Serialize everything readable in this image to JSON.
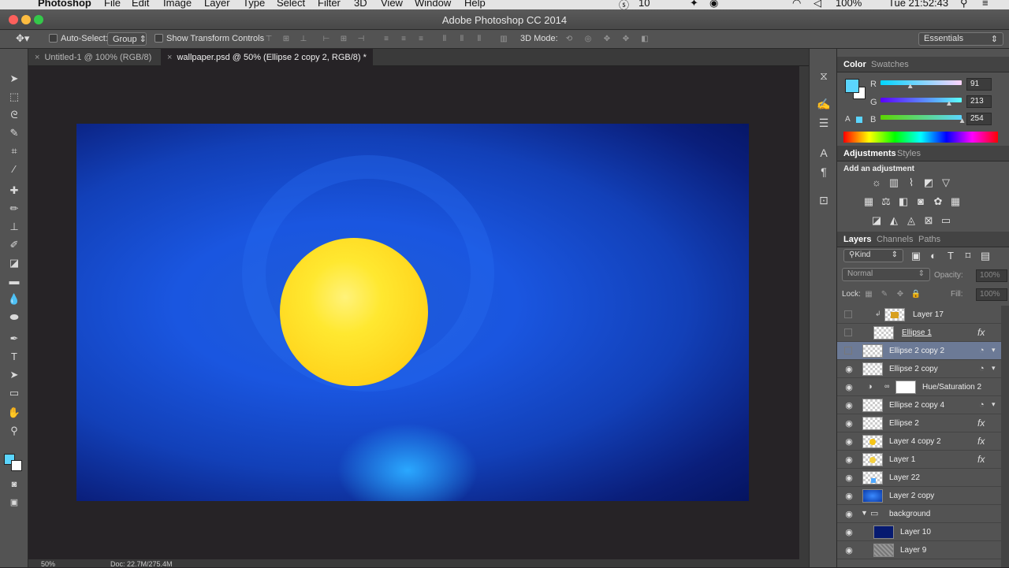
{
  "menubar": {
    "app": "Photoshop",
    "items": [
      "File",
      "Edit",
      "Image",
      "Layer",
      "Type",
      "Select",
      "Filter",
      "3D",
      "View",
      "Window",
      "Help"
    ],
    "status_count": "10",
    "battery": "100%",
    "clock": "Tue 21:52:43"
  },
  "window": {
    "title": "Adobe Photoshop CC 2014"
  },
  "options": {
    "auto_select_label": "Auto-Select:",
    "auto_select_value": "Group",
    "transform_label": "Show Transform Controls",
    "mode_3d_label": "3D Mode:",
    "workspace": "Essentials"
  },
  "tabs": [
    {
      "label": "Untitled-1 @ 100% (RGB/8)"
    },
    {
      "label": "wallpaper.psd @ 50% (Ellipse 2 copy 2, RGB/8) *"
    }
  ],
  "status": {
    "zoom": "50%",
    "doc": "Doc: 22.7M/275.4M"
  },
  "color_panel": {
    "tabs": [
      "Color",
      "Swatches"
    ],
    "r": {
      "label": "R",
      "value": "91"
    },
    "g": {
      "label": "G",
      "value": "213"
    },
    "b": {
      "label": "B",
      "value": "254"
    },
    "fg_color": "#5bd5fe",
    "r_level": 0.357,
    "g_level": 0.835,
    "b_level": 0.996
  },
  "adjustments_panel": {
    "tabs": [
      "Adjustments",
      "Styles"
    ],
    "heading": "Add an adjustment"
  },
  "layers_panel": {
    "tabs": [
      "Layers",
      "Channels",
      "Paths"
    ],
    "filter_kind": "Kind",
    "blend_mode": "Normal",
    "opacity_label": "Opacity:",
    "opacity_value": "100%",
    "lock_label": "Lock:",
    "fill_label": "Fill:",
    "fill_value": "100%",
    "layers": [
      {
        "name": "Layer 17",
        "visible": false
      },
      {
        "name": "Ellipse 1",
        "visible": false,
        "fx": true
      },
      {
        "name": "Ellipse 2 copy 2",
        "visible": false,
        "selected": true
      },
      {
        "name": "Ellipse 2 copy",
        "visible": false
      },
      {
        "name": "Hue/Saturation 2",
        "visible": true
      },
      {
        "name": "Ellipse 2 copy 4",
        "visible": true
      },
      {
        "name": "Ellipse 2",
        "visible": true,
        "fx": true
      },
      {
        "name": "Layer 4 copy 2",
        "visible": true,
        "fx": true
      },
      {
        "name": "Layer 1",
        "visible": true,
        "fx": true
      },
      {
        "name": "Layer 22",
        "visible": true
      },
      {
        "name": "Layer 2 copy",
        "visible": true
      },
      {
        "name": "background",
        "visible": true,
        "group": true
      },
      {
        "name": "Layer 10",
        "visible": true
      },
      {
        "name": "Layer 9",
        "visible": true
      }
    ],
    "fx_label": "fx"
  }
}
